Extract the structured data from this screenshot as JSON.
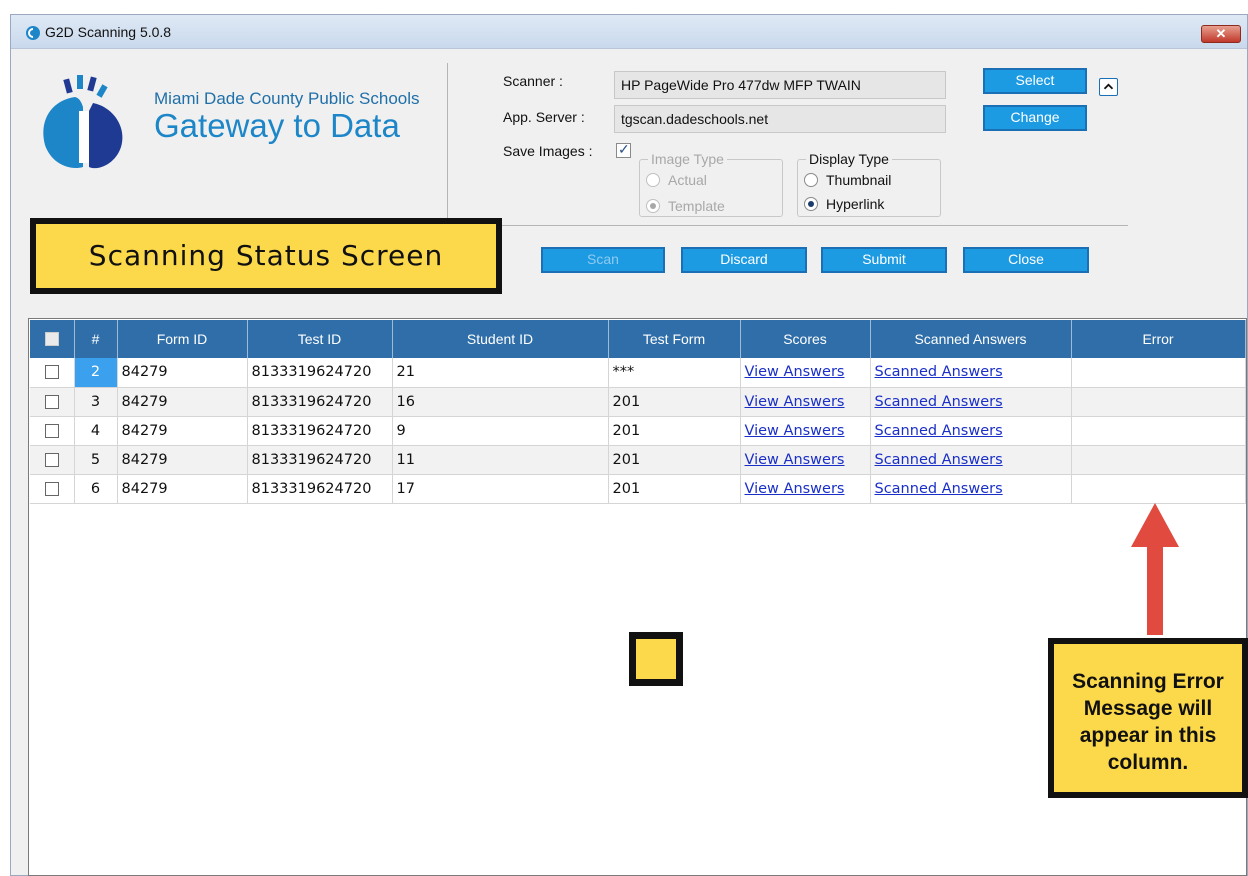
{
  "window": {
    "title": "G2D Scanning 5.0.8",
    "close_label": "✕"
  },
  "brand": {
    "org": "Miami Dade County Public Schools",
    "name": "Gateway to Data"
  },
  "settings": {
    "scanner_label": "Scanner :",
    "scanner_value": "HP PageWide Pro 477dw MFP TWAIN",
    "server_label": "App. Server :",
    "server_value": "tgscan.dadeschools.net",
    "save_images_label": "Save Images :",
    "save_images_checked": true,
    "select_label": "Select",
    "change_label": "Change",
    "image_type": {
      "legend": "Image Type",
      "options": [
        "Actual",
        "Template"
      ],
      "selected": "Template",
      "enabled": false
    },
    "display_type": {
      "legend": "Display Type",
      "options": [
        "Thumbnail",
        "Hyperlink"
      ],
      "selected": "Hyperlink"
    }
  },
  "actions": {
    "scan": "Scan",
    "discard": "Discard",
    "submit": "Submit",
    "close": "Close"
  },
  "status_banner": "Scanning Status Screen",
  "grid": {
    "columns": [
      "#",
      "Form ID",
      "Test ID",
      "Student ID",
      "Test Form",
      "Scores",
      "Scanned Answers",
      "Error"
    ],
    "rows": [
      {
        "num": "2",
        "form_id": "84279",
        "test_id": "8133319624720",
        "student_id": "21",
        "test_form": "***",
        "scores": "View Answers",
        "scanned": "Scanned Answers",
        "error": ""
      },
      {
        "num": "3",
        "form_id": "84279",
        "test_id": "8133319624720",
        "student_id": "16",
        "test_form": "201",
        "scores": "View Answers",
        "scanned": "Scanned Answers",
        "error": ""
      },
      {
        "num": "4",
        "form_id": "84279",
        "test_id": "8133319624720",
        "student_id": "9",
        "test_form": "201",
        "scores": "View Answers",
        "scanned": "Scanned Answers",
        "error": ""
      },
      {
        "num": "5",
        "form_id": "84279",
        "test_id": "8133319624720",
        "student_id": "11",
        "test_form": "201",
        "scores": "View Answers",
        "scanned": "Scanned Answers",
        "error": ""
      },
      {
        "num": "6",
        "form_id": "84279",
        "test_id": "8133319624720",
        "student_id": "17",
        "test_form": "201",
        "scores": "View Answers",
        "scanned": "Scanned Answers",
        "error": ""
      }
    ]
  },
  "callout": {
    "text": "Scanning Error Message will appear in this column."
  },
  "colors": {
    "accent": "#1c9be3",
    "header": "#2f6ea8",
    "highlight": "#fcd94a",
    "arrow": "#e04a3f",
    "link": "#1a2fc8"
  }
}
